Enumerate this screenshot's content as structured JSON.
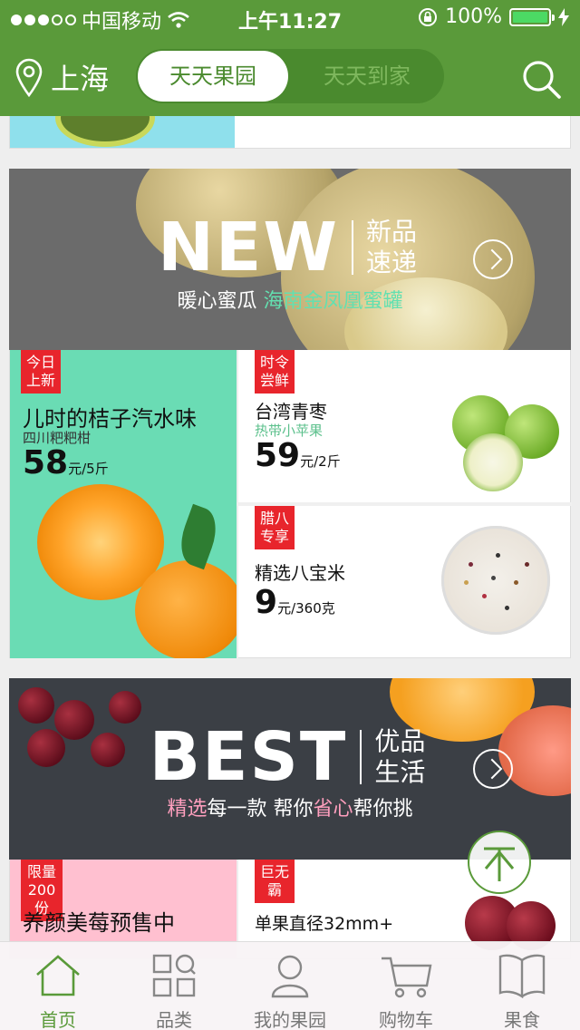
{
  "status_bar": {
    "carrier": "中国移动",
    "time": "上午11:27",
    "battery": "100%"
  },
  "header": {
    "location": "上海",
    "tabs": [
      "天天果园",
      "天天到家"
    ],
    "active_tab": 0,
    "search_icon": "search-icon",
    "location_icon": "location-pin-icon",
    "brand_color": "#5a9a3a"
  },
  "new_banner": {
    "big": "NEW",
    "small": "新品速递",
    "subtitle_plain": "暖心蜜瓜 ",
    "subtitle_highlight": "海南金凤凰蜜罐"
  },
  "new_items": [
    {
      "tag": "今日上新",
      "title": "儿时的桔子汽水味",
      "subtitle": "四川粑粑柑",
      "price": "58",
      "unit": "元/5斤"
    },
    {
      "tag": "时令尝鲜",
      "title": "台湾青枣",
      "subtitle": "热带小苹果",
      "price": "59",
      "unit": "元/2斤"
    },
    {
      "tag": "腊八专享",
      "title": "精选八宝米",
      "price": "9",
      "unit": "元/360克"
    }
  ],
  "best_banner": {
    "big": "BEST",
    "small": "优品生活",
    "sub_parts": [
      {
        "text": "精选",
        "hl": true
      },
      {
        "text": "每一款 帮你",
        "hl": false
      },
      {
        "text": "省心",
        "hl": true
      },
      {
        "text": "帮你挑",
        "hl": false
      }
    ]
  },
  "best_items": [
    {
      "tag": "限量200份",
      "title": "养颜美莓预售中"
    },
    {
      "tag": "巨无霸",
      "title": "单果直径32mm+"
    }
  ],
  "tab_bar": [
    {
      "label": "首页",
      "icon": "home-icon",
      "active": true
    },
    {
      "label": "品类",
      "icon": "category-grid-icon",
      "active": false
    },
    {
      "label": "我的果园",
      "icon": "user-icon",
      "active": false
    },
    {
      "label": "购物车",
      "icon": "cart-icon",
      "active": false
    },
    {
      "label": "果食",
      "icon": "book-icon",
      "active": false
    }
  ]
}
